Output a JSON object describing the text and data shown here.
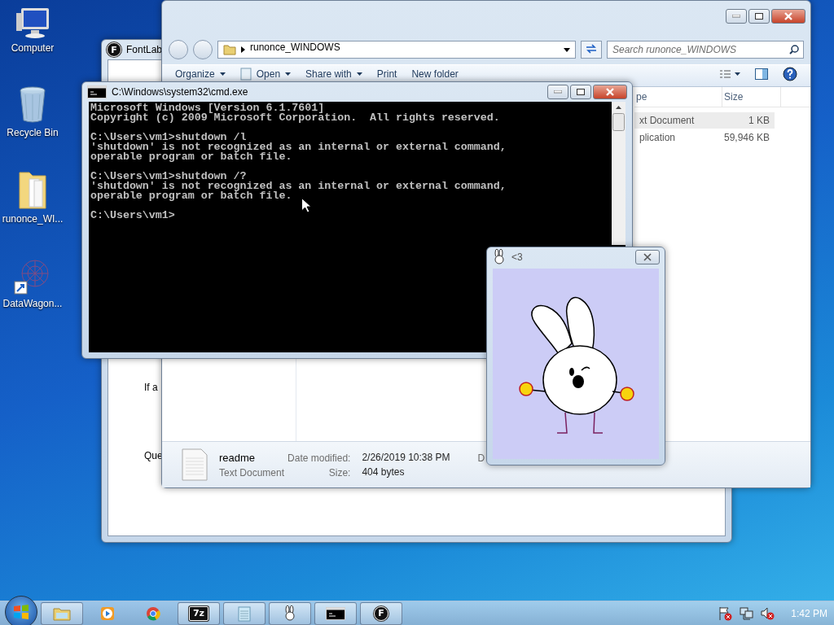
{
  "desktop_icons": [
    {
      "label": "Computer",
      "kind": "computer"
    },
    {
      "label": "Recycle Bin",
      "kind": "recycle"
    },
    {
      "label": "runonce_WI...",
      "kind": "folder"
    },
    {
      "label": "DataWagon...",
      "kind": "shortcut"
    }
  ],
  "fontlab_window": {
    "title": "FontLab",
    "logo": "F",
    "texts": [
      "If a",
      "Que"
    ]
  },
  "explorer": {
    "path": "runonce_WINDOWS",
    "search": {
      "placeholder": "Search runonce_WINDOWS"
    },
    "toolbar": [
      {
        "label": "Organize",
        "dropdown": true,
        "kind": "text"
      },
      {
        "label": "Open",
        "dropdown": true,
        "kind": "open"
      },
      {
        "label": "Share with",
        "dropdown": true,
        "kind": "text"
      },
      {
        "label": "Print",
        "dropdown": false,
        "kind": "text"
      },
      {
        "label": "New folder",
        "dropdown": false,
        "kind": "text"
      }
    ],
    "columns": [
      "pe",
      "Size"
    ],
    "rows": [
      {
        "column_1": "xt Document",
        "size": "1 KB",
        "selected": true
      },
      {
        "column_1": "plication",
        "size": "59,946 KB",
        "selected": false
      }
    ],
    "details": {
      "name": "readme",
      "type": "Text Document",
      "date_label": "Date modified:",
      "date": "2/26/2019 10:38 PM",
      "size_label": "Size:",
      "size": "404 bytes",
      "column_3": "D"
    }
  },
  "cmd": {
    "title": "C:\\Windows\\system32\\cmd.exe",
    "blocks": [
      [
        "Microsoft Windows [Version 6.1.7601]",
        "Copyright (c) 2009 Microsoft Corporation.  All rights reserved."
      ],
      [
        "C:\\Users\\vm1>shutdown /l",
        "'shutdown' is not recognized as an internal or external command,",
        "operable program or batch file."
      ],
      [
        "C:\\Users\\vm1>shutdown /?",
        "'shutdown' is not recognized as an internal or external command,",
        "operable program or batch file."
      ],
      [
        "C:\\Users\\vm1>"
      ]
    ]
  },
  "pet_window": {
    "title": "<3"
  },
  "taskbar": {
    "items": [
      {
        "kind": "explorer",
        "running": true
      },
      {
        "kind": "media",
        "running": false
      },
      {
        "kind": "chrome",
        "running": false
      },
      {
        "kind": "archive",
        "running": true,
        "glyph": "7z"
      },
      {
        "kind": "notepad",
        "running": true
      },
      {
        "kind": "pet",
        "running": true
      },
      {
        "kind": "cmd",
        "running": true
      },
      {
        "kind": "fontlab",
        "running": true,
        "glyph": "F"
      }
    ],
    "clock": "1:42 PM"
  }
}
